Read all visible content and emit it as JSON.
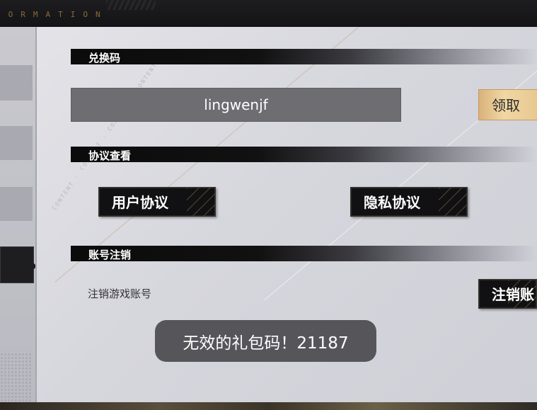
{
  "topbar": {
    "deco_text": "FORMATION"
  },
  "main": {
    "watermark": "CONTENT · CONTENT · CONTENT · CONTENT",
    "redeem": {
      "header": "兑换码",
      "code_value": "lingwenjf",
      "claim_label": "领取"
    },
    "agreements": {
      "header": "协议查看",
      "user_agreement_label": "用户协议",
      "privacy_agreement_label": "隐私协议"
    },
    "account_cancel": {
      "header": "账号注销",
      "description": "注销游戏账号",
      "button_label": "注销账"
    }
  },
  "toast": {
    "message": "无效的礼包码！21187"
  },
  "colors": {
    "accent_gold": "#e7c68e",
    "panel_bg": "#d6d6dd",
    "dark_button": "#111113",
    "input_bg": "#6d6d72"
  }
}
